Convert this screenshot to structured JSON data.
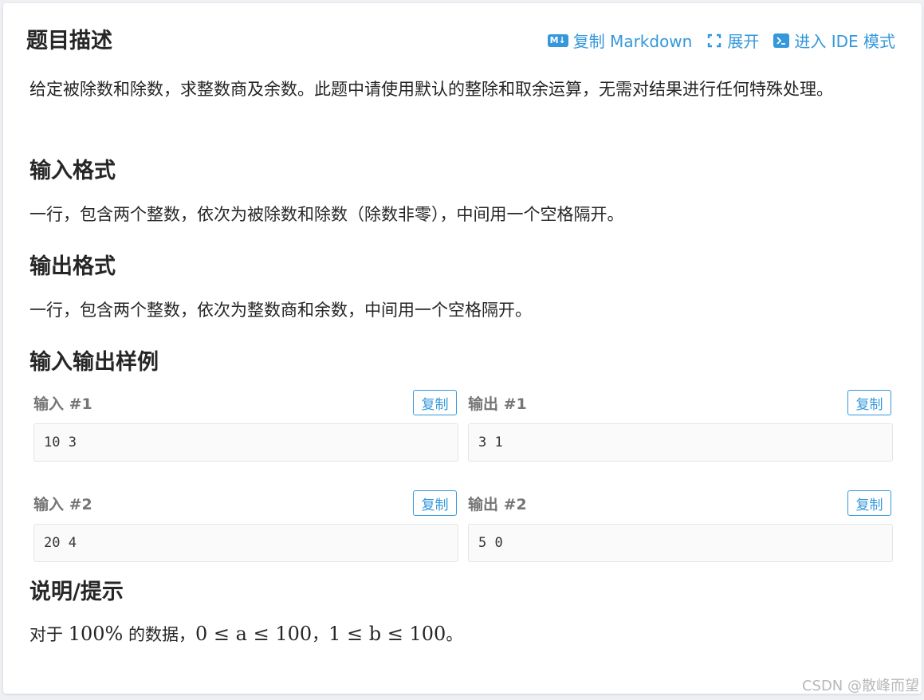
{
  "section_title": "题目描述",
  "actions": {
    "copy_markdown_icon": "M↓",
    "copy_markdown": "复制 Markdown",
    "expand": "展开",
    "ide_mode": "进入 IDE 模式"
  },
  "description": "给定被除数和除数，求整数商及余数。此题中请使用默认的整除和取余运算，无需对结果进行任何特殊处理。",
  "input_format": {
    "title": "输入格式",
    "text": "一行，包含两个整数，依次为被除数和除数（除数非零），中间用一个空格隔开。"
  },
  "output_format": {
    "title": "输出格式",
    "text": "一行，包含两个整数，依次为整数商和余数，中间用一个空格隔开。"
  },
  "samples": {
    "title": "输入输出样例",
    "copy_label": "复制",
    "items": [
      {
        "input_label": "输入 #1",
        "input": "10 3",
        "output_label": "输出 #1",
        "output": "3 1"
      },
      {
        "input_label": "输入 #2",
        "input": "20 4",
        "output_label": "输出 #2",
        "output": "5 0"
      }
    ]
  },
  "hint": {
    "title": "说明/提示",
    "prefix": "对于",
    "percent": "100%",
    "middle": "的数据，",
    "cond_a": "0 ≤ a ≤ 100",
    "sep": "，",
    "cond_b": "1 ≤ b ≤ 100",
    "end": "。"
  },
  "watermark": "CSDN @散峰而望",
  "colors": {
    "accent": "#3498db",
    "text": "#262626",
    "label": "#757575"
  }
}
